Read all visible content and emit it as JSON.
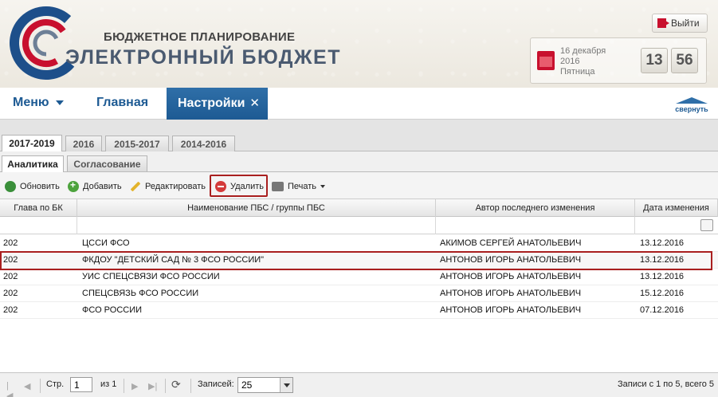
{
  "header": {
    "brand_top": "БЮДЖЕТНОЕ ПЛАНИРОВАНИЕ",
    "brand_main": "ЭЛЕКТРОННЫЙ БЮДЖЕТ",
    "exit_label": "Выйти",
    "date_line1": "16 декабря",
    "date_line2": "2016",
    "date_line3": "Пятница",
    "clock_hours": "13",
    "clock_minutes": "56"
  },
  "nav": {
    "menu_label": "Меню",
    "home_label": "Главная",
    "active_label": "Настройки",
    "close_glyph": "✕",
    "collapse_label": "свернуть"
  },
  "year_tabs": [
    "2017-2019",
    "2016",
    "2015-2017",
    "2014-2016"
  ],
  "sub_tabs": [
    "Аналитика",
    "Согласование"
  ],
  "toolbar": {
    "refresh": "Обновить",
    "add": "Добавить",
    "edit": "Редактировать",
    "delete": "Удалить",
    "print": "Печать"
  },
  "grid": {
    "columns": [
      "Глава по БК",
      "Наименование ПБС / группы ПБС",
      "Автор последнего изменения",
      "Дата изменения"
    ],
    "rows": [
      {
        "chapter": "202",
        "name": "ЦССИ ФСО",
        "author": "АКИМОВ СЕРГЕЙ АНАТОЛЬЕВИЧ",
        "date": "13.12.2016"
      },
      {
        "chapter": "202",
        "name": "ФКДОУ \"ДЕТСКИЙ САД № 3 ФСО РОССИИ\"",
        "author": "АНТОНОВ ИГОРЬ АНАТОЛЬЕВИЧ",
        "date": "13.12.2016"
      },
      {
        "chapter": "202",
        "name": "УИС СПЕЦСВЯЗИ ФСО РОССИИ",
        "author": "АНТОНОВ ИГОРЬ АНАТОЛЬЕВИЧ",
        "date": "13.12.2016"
      },
      {
        "chapter": "202",
        "name": "СПЕЦСВЯЗЬ ФСО РОССИИ",
        "author": "АНТОНОВ ИГОРЬ АНАТОЛЬЕВИЧ",
        "date": "15.12.2016"
      },
      {
        "chapter": "202",
        "name": "ФСО РОССИИ",
        "author": "АНТОНОВ ИГОРЬ АНАТОЛЬЕВИЧ",
        "date": "07.12.2016"
      }
    ]
  },
  "pager": {
    "page_label": "Стр.",
    "page_value": "1",
    "of_label": "из 1",
    "records_label": "Записей:",
    "records_value": "25",
    "summary": "Записи с 1 по 5, всего 5"
  },
  "colors": {
    "accent": "#1d5a93",
    "highlight": "#a91f1f"
  }
}
